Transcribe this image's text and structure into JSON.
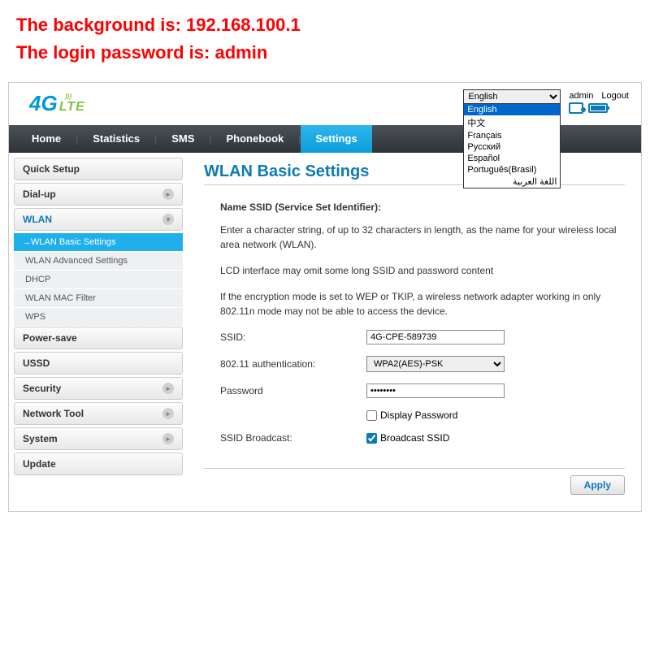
{
  "annotation": {
    "line1": "The background is: 192.168.100.1",
    "line2": "The login password is: admin"
  },
  "logo": {
    "four": "4",
    "g": "G",
    "lte": "LTE"
  },
  "top": {
    "lang_selected": "English",
    "lang_options": [
      "English",
      "中文",
      "Français",
      "Русский",
      "Español",
      "Português(Brasil)",
      "اللغة العربية"
    ],
    "user": "admin",
    "logout": "Logout"
  },
  "nav": [
    "Home",
    "Statistics",
    "SMS",
    "Phonebook",
    "Settings"
  ],
  "nav_active": "Settings",
  "sidebar": {
    "quick_setup": "Quick Setup",
    "dialup": "Dial-up",
    "wlan": "WLAN",
    "wlan_subs": [
      "WLAN Basic Settings",
      "WLAN Advanced Settings",
      "DHCP",
      "WLAN MAC Filter",
      "WPS"
    ],
    "powersave": "Power-save",
    "ussd": "USSD",
    "security": "Security",
    "network_tool": "Network Tool",
    "system": "System",
    "update": "Update"
  },
  "content": {
    "title": "WLAN Basic Settings",
    "ssid_heading": "Name SSID (Service Set Identifier):",
    "p1": "Enter a character string, of up to 32 characters in length, as the name for your wireless local area network (WLAN).",
    "p2": "LCD interface may omit some long SSID and password content",
    "p3": "If the encryption mode is set to WEP or TKIP, a wireless network adapter working in only 802.11n mode may not be able to access the device.",
    "ssid_label": "SSID:",
    "ssid_value": "4G-CPE-589739",
    "auth_label": "802.11 authentication:",
    "auth_value": "WPA2(AES)-PSK",
    "password_label": "Password",
    "password_value": "••••••••",
    "display_password": "Display Password",
    "broadcast_label": "SSID Broadcast:",
    "broadcast_check": "Broadcast SSID",
    "apply": "Apply"
  }
}
